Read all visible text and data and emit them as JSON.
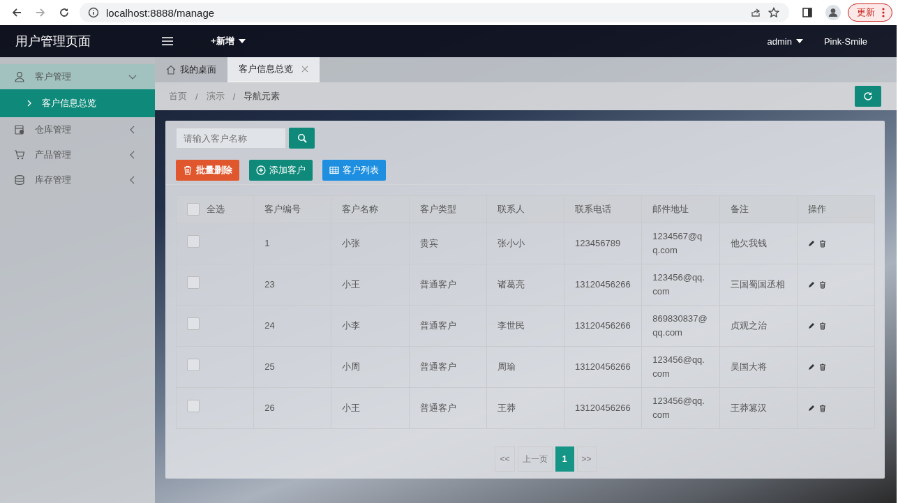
{
  "browser": {
    "url": "localhost:8888/manage",
    "update_button": "更新"
  },
  "header": {
    "title": "用户管理页面",
    "add_menu": "+新增",
    "user": "admin",
    "theme": "Pink-Smile"
  },
  "sidebar": {
    "items": [
      {
        "label": "客户管理",
        "kind": "user",
        "expanded": true,
        "children": [
          {
            "label": "客户信息总览",
            "selected": true
          }
        ]
      },
      {
        "label": "仓库管理",
        "kind": "warehouse",
        "expanded": false
      },
      {
        "label": "产品管理",
        "kind": "cart",
        "expanded": false
      },
      {
        "label": "库存管理",
        "kind": "database",
        "expanded": false
      }
    ]
  },
  "tabs": [
    {
      "label": "我的桌面",
      "kind": "home",
      "selected": false
    },
    {
      "label": "客户信息总览",
      "kind": "page",
      "selected": true
    }
  ],
  "breadcrumb": {
    "items": [
      "首页",
      "演示",
      "导航元素"
    ],
    "separators": [
      "/",
      "/"
    ]
  },
  "search": {
    "placeholder": "请输入客户名称"
  },
  "buttons": [
    {
      "label": "批量删除",
      "kind": "danger"
    },
    {
      "label": "添加客户",
      "kind": "add"
    },
    {
      "label": "客户列表",
      "kind": "list"
    }
  ],
  "table": {
    "select_all": {
      "label": "全选",
      "checked": false
    },
    "columns": [
      "客户编号",
      "客户名称",
      "客户类型",
      "联系人",
      "联系电话",
      "邮件地址",
      "备注",
      "操作"
    ],
    "rows": [
      {
        "checked": false,
        "cells": [
          "1",
          "小张",
          "贵宾",
          "张小小",
          "123456789",
          "1234567@qq.com",
          "他欠我钱"
        ]
      },
      {
        "checked": false,
        "cells": [
          "23",
          "小王",
          "普通客户",
          "诸葛亮",
          "13120456266",
          "123456@qq.com",
          "三国蜀国丞相"
        ]
      },
      {
        "checked": false,
        "cells": [
          "24",
          "小李",
          "普通客户",
          "李世民",
          "13120456266",
          "869830837@qq.com",
          "贞观之治"
        ]
      },
      {
        "checked": false,
        "cells": [
          "25",
          "小周",
          "普通客户",
          "周瑜",
          "13120456266",
          "123456@qq.com",
          "吴国大将"
        ]
      },
      {
        "checked": false,
        "cells": [
          "26",
          "小王",
          "普通客户",
          "王莽",
          "13120456266",
          "123456@qq.com",
          "王莽篡汉"
        ]
      }
    ]
  },
  "pagination": [
    {
      "label": "<<",
      "selected": false
    },
    {
      "label": "上一页",
      "selected": false
    },
    {
      "label": "1",
      "selected": true
    },
    {
      "label": ">>",
      "selected": false
    }
  ]
}
